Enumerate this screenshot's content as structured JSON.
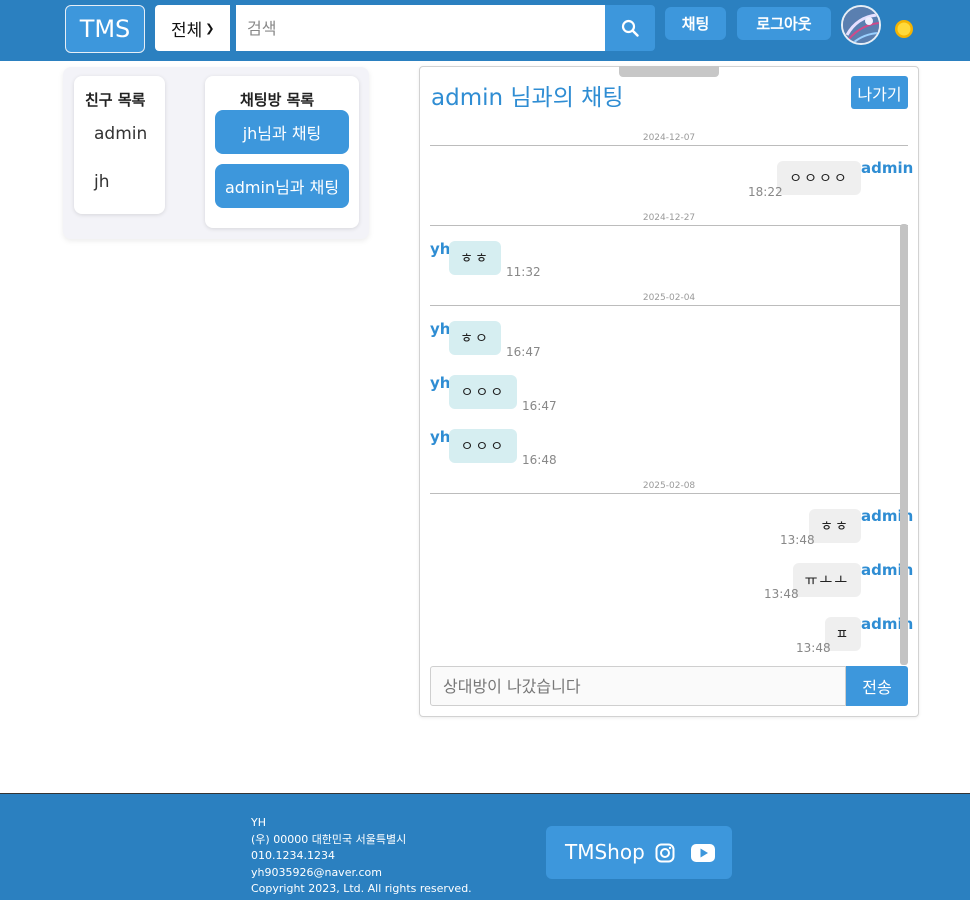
{
  "header": {
    "logo": "TMS",
    "category_select": "전체",
    "search_placeholder": "검색",
    "chat_label": "채팅",
    "logout_label": "로그아웃"
  },
  "sidebar": {
    "friends_title": "친구 목록",
    "friends": [
      "admin",
      "jh"
    ],
    "rooms_title": "채팅방 목록",
    "rooms": [
      "jh님과 채팅",
      "admin님과 채팅"
    ]
  },
  "chat": {
    "title": "admin 님과의 채팅",
    "leave_label": "나가기",
    "dates": [
      "2024-12-07",
      "2024-12-27",
      "2025-02-04",
      "2025-02-08"
    ],
    "messages": [
      {
        "sender": "admin",
        "text": "ㅇㅇㅇㅇ",
        "time": "18:22"
      },
      {
        "sender": "yh",
        "text": "ㅎㅎ",
        "time": "11:32"
      },
      {
        "sender": "yh",
        "text": "ㅎㅇ",
        "time": "16:47"
      },
      {
        "sender": "yh",
        "text": "ㅇㅇㅇ",
        "time": "16:47"
      },
      {
        "sender": "yh",
        "text": "ㅇㅇㅇ",
        "time": "16:48"
      },
      {
        "sender": "admin",
        "text": "ㅎㅎ",
        "time": "13:48"
      },
      {
        "sender": "admin",
        "text": "ㅠㅗㅗ",
        "time": "13:48"
      },
      {
        "sender": "admin",
        "text": "ㅍ",
        "time": "13:48"
      }
    ],
    "input_placeholder": "상대방이 나갔습니다",
    "send_label": "전송"
  },
  "footer": {
    "name": "YH",
    "address": "(우) 00000 대한민국 서울특별시",
    "phone": "010.1234.1234",
    "email": "yh9035926@naver.com",
    "copyright": "Copyright 2023, Ltd. All rights reserved.",
    "brand": "TMShop"
  },
  "colors": {
    "primary": "#2b80c0",
    "button": "#3d97dc",
    "theirs_bubble": "#d6eef1",
    "mine_bubble": "#efefef"
  }
}
